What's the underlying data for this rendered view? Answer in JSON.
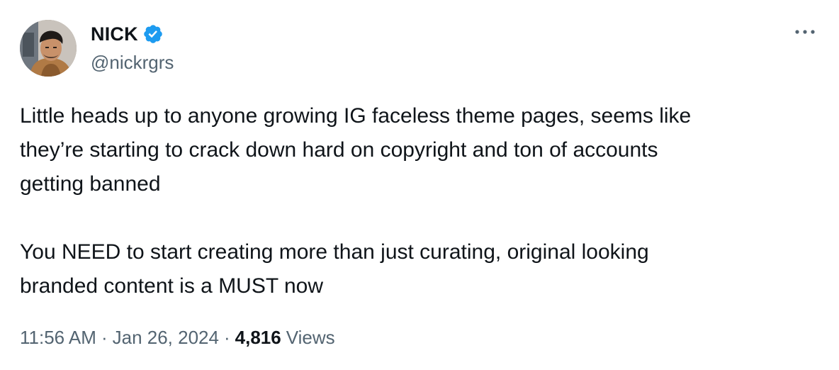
{
  "author": {
    "display_name": "NICK",
    "handle": "@nickrgrs",
    "verified": true,
    "avatar_icon": "profile-photo",
    "verified_icon": "verified-badge-icon",
    "verified_color": "#1d9bf0"
  },
  "menu": {
    "more_icon": "more-options-icon"
  },
  "tweet": {
    "paragraphs": [
      "Little heads up to anyone growing IG faceless theme pages, seems like\nthey’re starting to crack down hard on copyright and ton of accounts\ngetting banned",
      "You NEED to start creating more than just curating, original looking\nbranded content is a MUST now"
    ]
  },
  "meta": {
    "time": "11:56 AM",
    "separator": "·",
    "date": "Jan 26, 2024",
    "views_count": "4,816",
    "views_label": "Views"
  },
  "colors": {
    "text_primary": "#0f1419",
    "text_secondary": "#536471",
    "accent": "#1d9bf0"
  }
}
